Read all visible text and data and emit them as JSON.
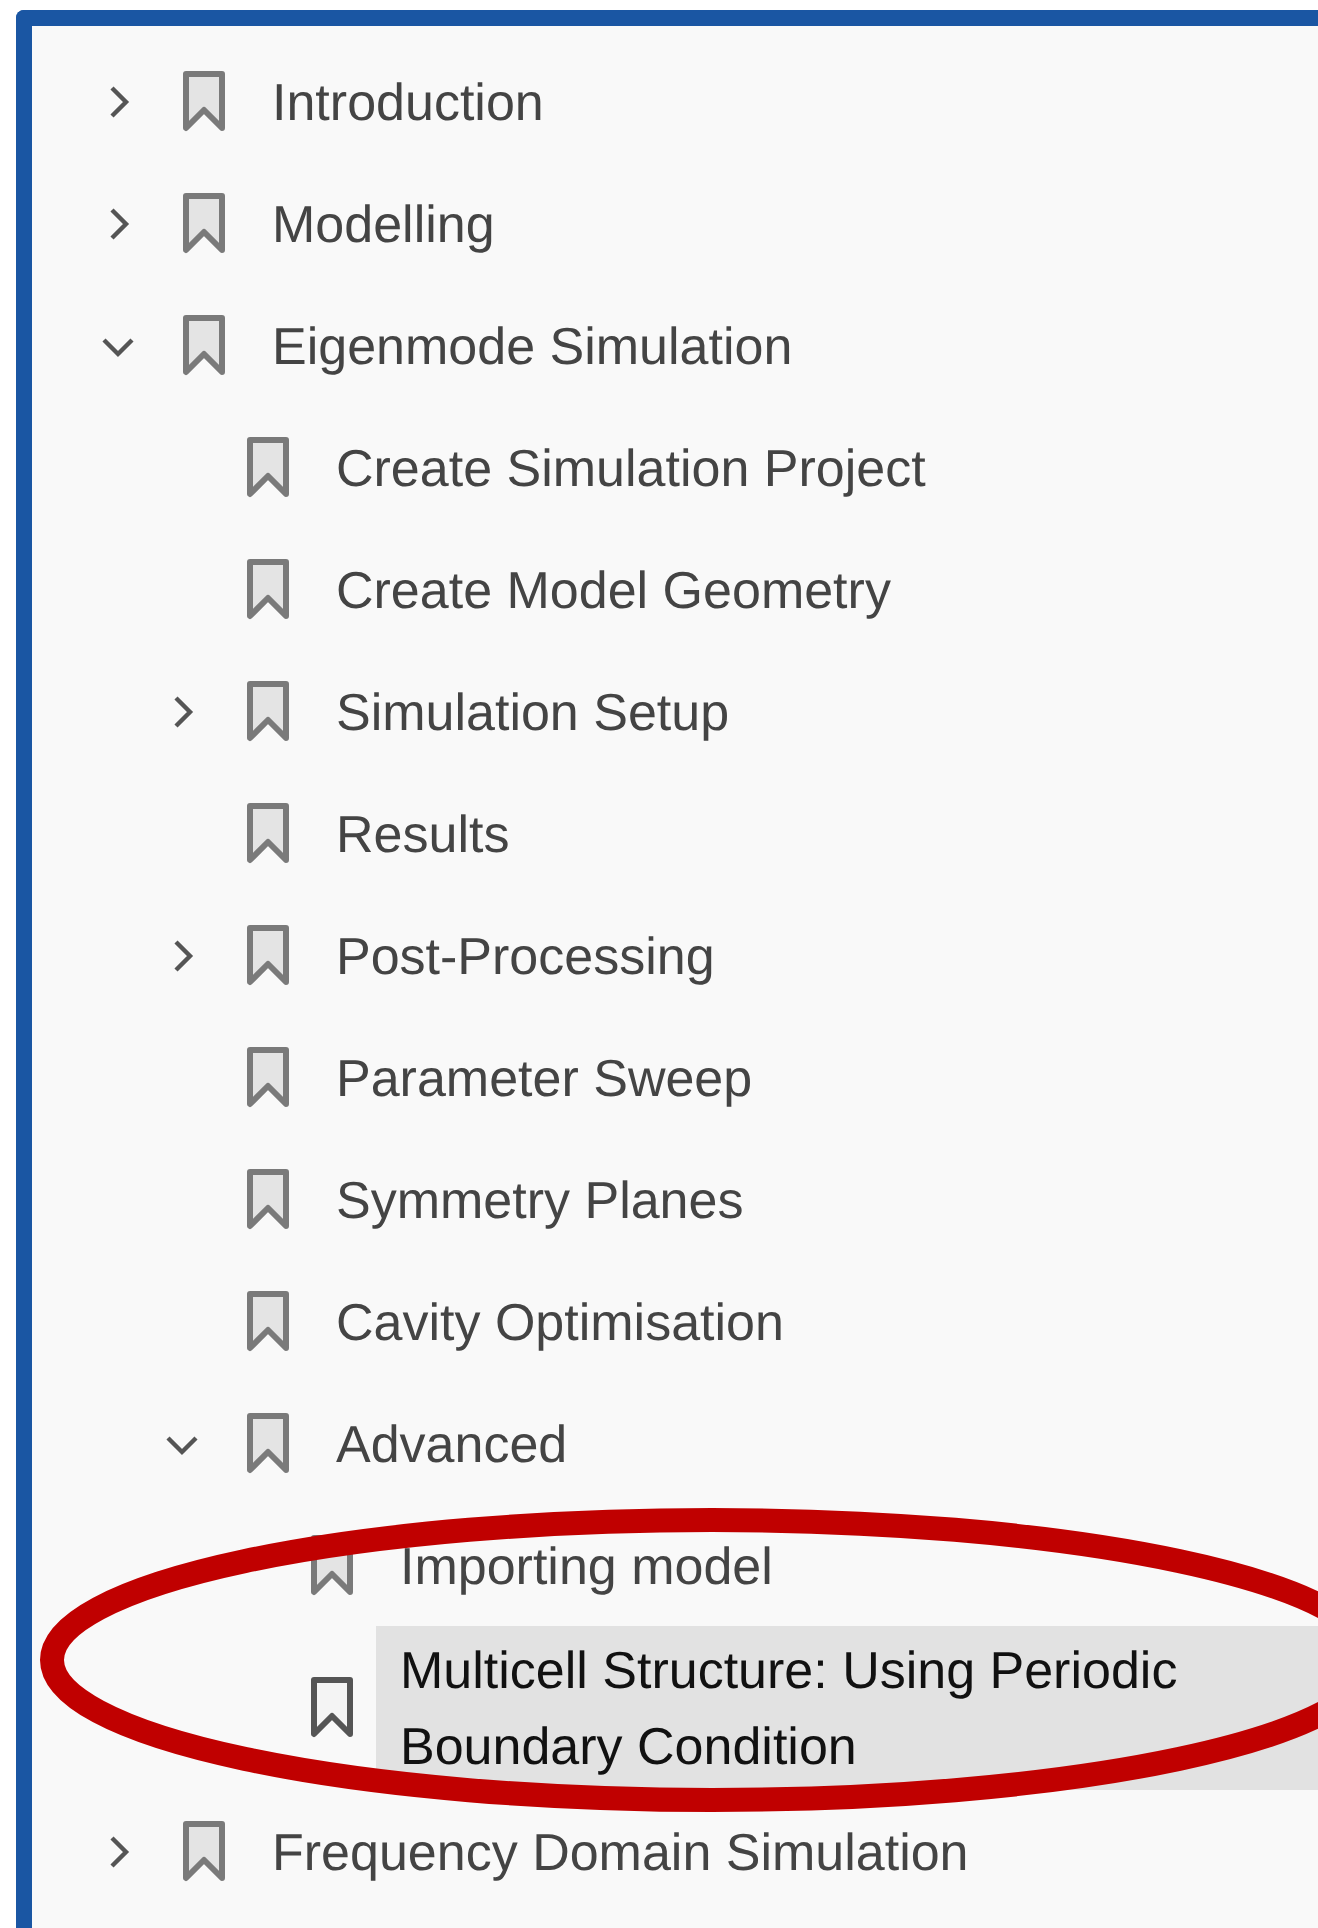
{
  "bookmarks": [
    {
      "label": "Introduction",
      "expanded": false,
      "selected": false
    },
    {
      "label": "Modelling",
      "expanded": false,
      "selected": false
    },
    {
      "label": "Eigenmode Simulation",
      "expanded": true,
      "selected": false,
      "children": [
        {
          "label": "Create Simulation Project",
          "selected": false
        },
        {
          "label": "Create Model Geometry",
          "selected": false
        },
        {
          "label": "Simulation Setup",
          "expanded": false,
          "selected": false
        },
        {
          "label": "Results",
          "selected": false
        },
        {
          "label": "Post-Processing",
          "expanded": false,
          "selected": false
        },
        {
          "label": "Parameter Sweep",
          "selected": false
        },
        {
          "label": "Symmetry Planes",
          "selected": false
        },
        {
          "label": "Cavity Optimisation",
          "selected": false
        },
        {
          "label": "Advanced",
          "expanded": true,
          "selected": false,
          "children": [
            {
              "label": "Importing model",
              "selected": false
            },
            {
              "label": "Multicell Structure: Using Periodic Boundary Condition",
              "selected": true
            }
          ]
        }
      ]
    },
    {
      "label": "Frequency Domain Simulation",
      "expanded": false,
      "selected": false
    }
  ]
}
